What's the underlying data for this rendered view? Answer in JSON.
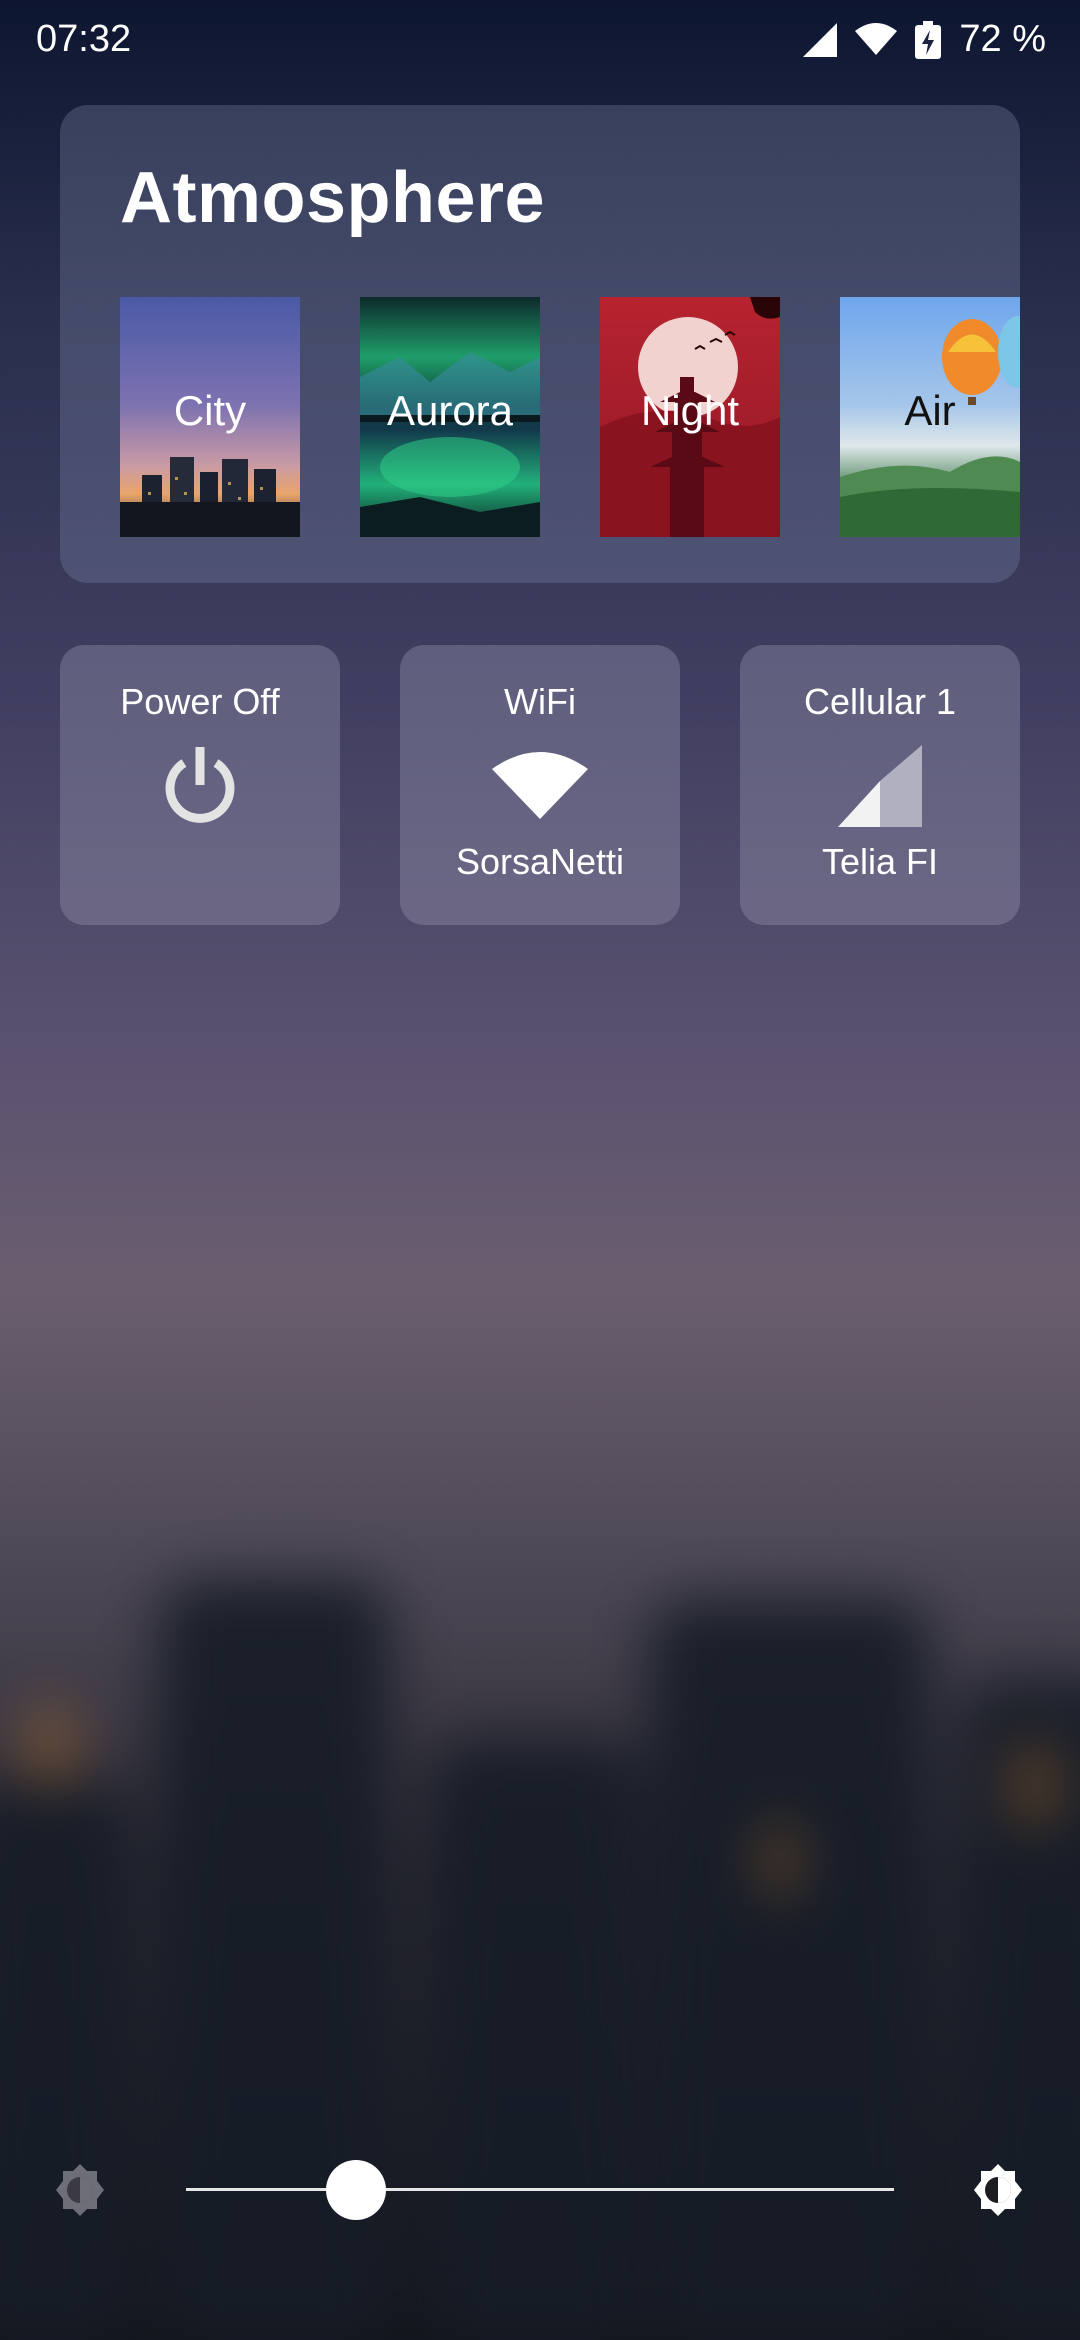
{
  "status_bar": {
    "time": "07:32",
    "battery": "72 %",
    "icons": [
      "cellular-signal-icon",
      "wifi-icon",
      "battery-charging-icon"
    ]
  },
  "ambience": {
    "title": "Atmosphere",
    "items": [
      {
        "label": "City"
      },
      {
        "label": "Aurora"
      },
      {
        "label": "Night"
      },
      {
        "label": "Air"
      }
    ]
  },
  "toggles": {
    "power": {
      "title": "Power Off",
      "icon": "power-icon"
    },
    "wifi": {
      "title": "WiFi",
      "subtitle": "SorsaNetti",
      "icon": "wifi-icon"
    },
    "cellular": {
      "title": "Cellular 1",
      "subtitle": "Telia FI",
      "icon": "cellular-signal-icon"
    }
  },
  "brightness": {
    "level": 0.24,
    "icons": [
      "brightness-low-icon",
      "brightness-high-icon"
    ]
  }
}
